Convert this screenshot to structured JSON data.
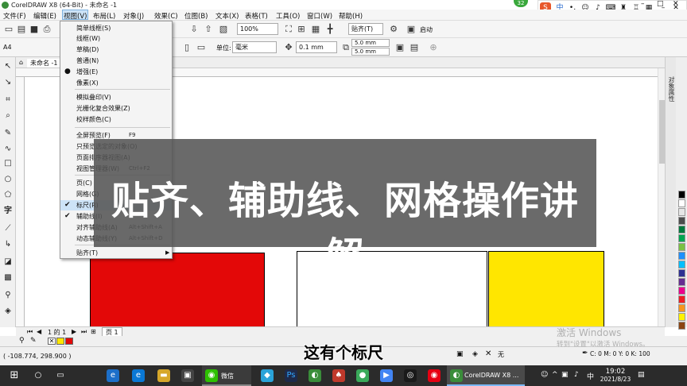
{
  "window": {
    "title": "CorelDRAW X8 (64-Bit) - 未命名 -1"
  },
  "menubar": {
    "items": [
      "文件(F)",
      "编辑(E)",
      "视图(V)",
      "布局(L)",
      "对象(J)",
      "效果(C)",
      "位图(B)",
      "文本(X)",
      "表格(T)",
      "工具(O)",
      "窗口(W)",
      "帮助(H)"
    ],
    "active_index": 2
  },
  "toolbar1": {
    "zoom": "100%",
    "snap_label": "贴齐(T)",
    "launch_label": "启动"
  },
  "toolbar2": {
    "page_size": "A4",
    "unit_label": "单位:",
    "unit_value": "毫米",
    "nudge": "0.1 mm",
    "dup_x": "5.0 mm",
    "dup_y": "5.0 mm"
  },
  "doc_tab": {
    "label": "未命名 -1"
  },
  "view_menu": {
    "items": [
      {
        "label": "简单线框(S)",
        "shortcut": "",
        "mark": ""
      },
      {
        "label": "线框(W)",
        "shortcut": "",
        "mark": ""
      },
      {
        "label": "草稿(D)",
        "shortcut": "",
        "mark": ""
      },
      {
        "label": "普通(N)",
        "shortcut": "",
        "mark": ""
      },
      {
        "label": "增强(E)",
        "shortcut": "",
        "mark": "●"
      },
      {
        "label": "像素(X)",
        "shortcut": "",
        "mark": ""
      },
      {
        "label": "模拟叠印(V)",
        "shortcut": "",
        "mark": ""
      },
      {
        "label": "光栅化复合效果(Z)",
        "shortcut": "",
        "mark": ""
      },
      {
        "label": "校样颜色(C)",
        "shortcut": "",
        "mark": ""
      },
      {
        "label": "全屏预览(F)",
        "shortcut": "F9",
        "mark": ""
      },
      {
        "label": "只预览选定的对象(O)",
        "shortcut": "",
        "mark": ""
      },
      {
        "label": "页面排序器视图(A)",
        "shortcut": "",
        "mark": ""
      },
      {
        "label": "视图管理器(W)",
        "shortcut": "Ctrl+F2",
        "mark": ""
      },
      {
        "label": "页(C)",
        "shortcut": "",
        "mark": ""
      },
      {
        "label": "网格(G)",
        "shortcut": "",
        "mark": ""
      },
      {
        "label": "标尺(R)",
        "shortcut": "",
        "mark": "✔"
      },
      {
        "label": "辅助线(I)",
        "shortcut": "",
        "mark": "✔"
      },
      {
        "label": "对齐辅助线(A)",
        "shortcut": "Alt+Shift+A",
        "mark": ""
      },
      {
        "label": "动态辅助线(Y)",
        "shortcut": "Alt+Shift+D",
        "mark": ""
      },
      {
        "label": "贴齐(T)",
        "shortcut": "",
        "mark": ""
      }
    ]
  },
  "overlay": {
    "headline": "贴齐、辅助线、网格操作讲解"
  },
  "subtitle": {
    "text": "这有个标尺"
  },
  "pagebar": {
    "page_info": "1 的 1",
    "page_tab": "页 1"
  },
  "watermark": {
    "line1": "激活 Windows",
    "line2": "转到\"设置\"以激活 Windows。"
  },
  "status": {
    "coords": "( -108.774, 298.900 )",
    "fill_none": "无",
    "cmyk": "C: 0 M: 0 Y: 0 K: 100"
  },
  "badge": {
    "count": "32"
  },
  "ime": {
    "label": "中"
  },
  "taskbar": {
    "wechat": "微信",
    "app": "CorelDRAW X8 ...",
    "time": "19:02",
    "date": "2021/8/23",
    "ime_indicator": "中"
  },
  "docker": {
    "label": "对象属性"
  },
  "colors": {
    "red": "#e30808",
    "yellow": "#ffe600",
    "overlay": "#555555",
    "accent": "#3a8d3a"
  },
  "palette": [
    "#000000",
    "#ffffff",
    "#e6e6e6",
    "#4d4d4d",
    "#007a3d",
    "#00a651",
    "#7ac143",
    "#1e90ff",
    "#00bfff",
    "#2e3192",
    "#662d91",
    "#ec008c",
    "#ed1c24",
    "#f7941d",
    "#fff200",
    "#8b4513"
  ]
}
